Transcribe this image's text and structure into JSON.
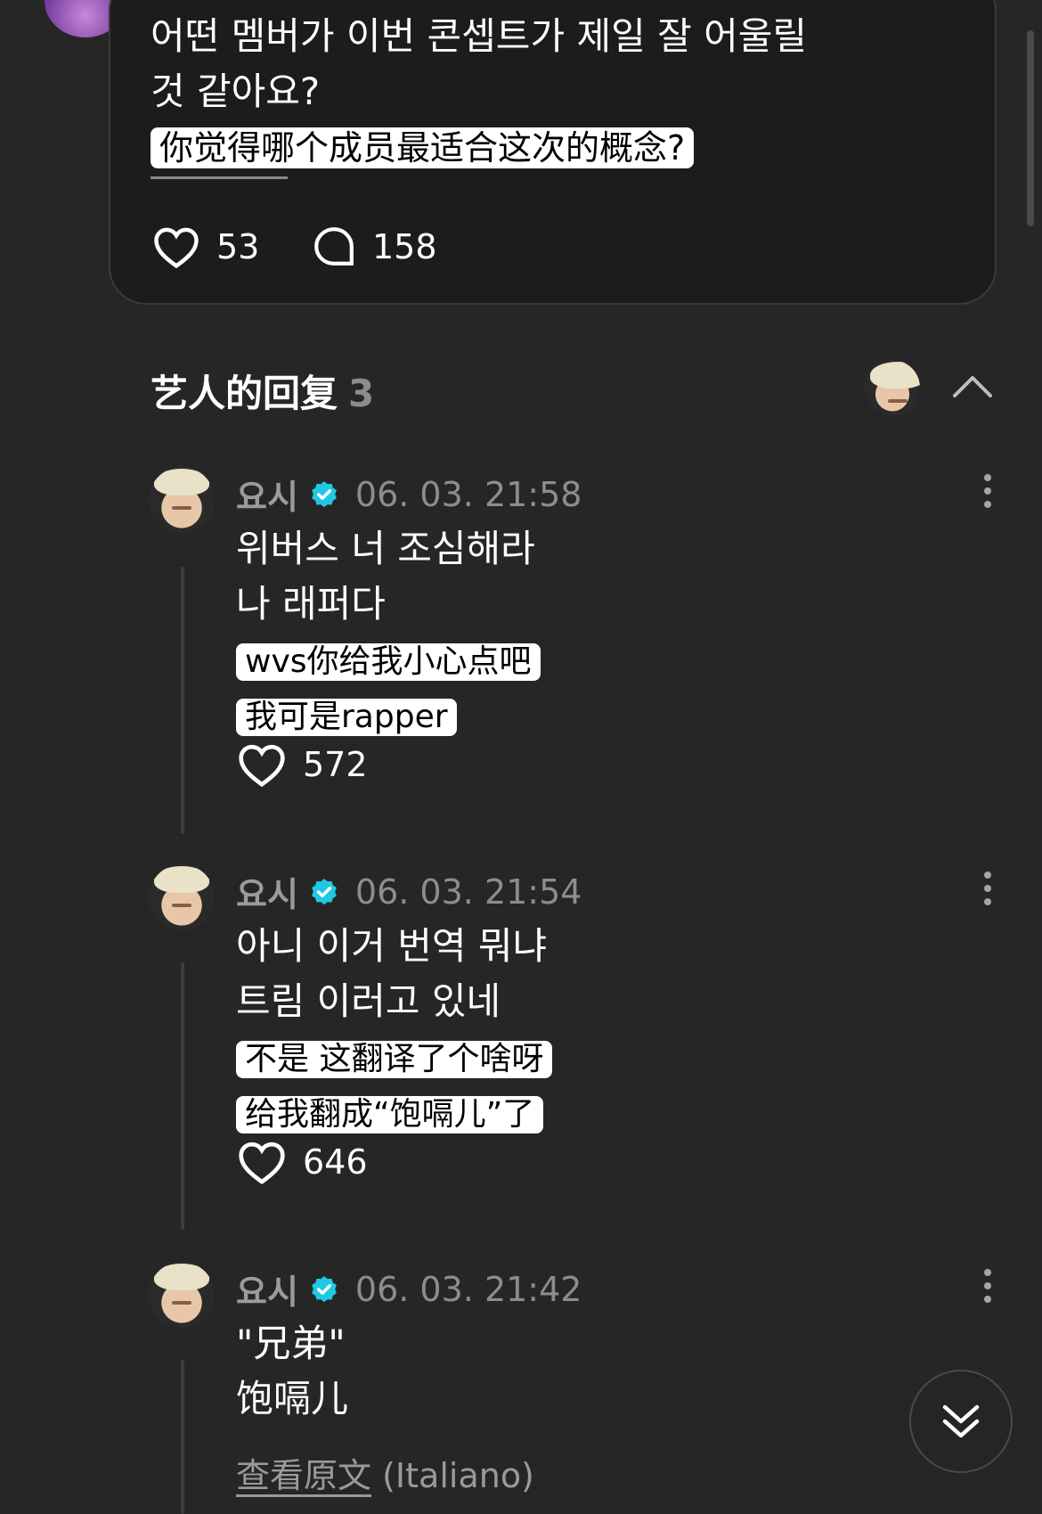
{
  "post": {
    "text_line1": "어떤 멤버가 이번 콘셉트가 제일 잘 어울릴",
    "text_line2": "것 같아요?",
    "translation": "你觉得哪个成员最适合这次的概念?",
    "likes": "53",
    "comments": "158"
  },
  "replies_section": {
    "title": "艺人的回复",
    "count": "3"
  },
  "comments": [
    {
      "username": "요시",
      "timestamp": "06. 03. 21:58",
      "line1": "위버스 너 조심해라",
      "line2": "나 래퍼다",
      "caption1": "wvs你给我小心点吧",
      "caption2": "我可是rapper",
      "likes": "572"
    },
    {
      "username": "요시",
      "timestamp": "06. 03. 21:54",
      "line1": "아니 이거 번역 뭐냐",
      "line2": "트림 이러고 있네",
      "caption1": "不是 这翻译了个啥呀",
      "caption2": "给我翻成“饱嗝儿”了",
      "likes": "646"
    },
    {
      "username": "요시",
      "timestamp": "06. 03. 21:42",
      "line1": "\"兄弟\"",
      "line2": "饱嗝儿",
      "see_original": "查看原文",
      "original_language": "(Italiano)"
    }
  ],
  "colors": {
    "background": "#262626",
    "card": "#1c1c1c",
    "verified": "#1fc9e6",
    "muted": "#8d8d8d"
  }
}
